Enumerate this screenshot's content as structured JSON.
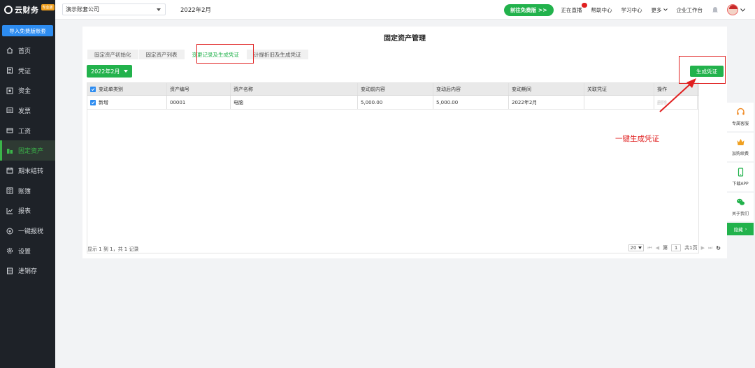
{
  "brand": {
    "name": "云财务",
    "badge": "专业版"
  },
  "sidebar": {
    "import_label": "导入免费版账套",
    "items": [
      {
        "label": "首页",
        "icon": "home-icon",
        "active": false
      },
      {
        "label": "凭证",
        "icon": "voucher-icon",
        "active": false
      },
      {
        "label": "资金",
        "icon": "funds-icon",
        "active": false
      },
      {
        "label": "发票",
        "icon": "invoice-icon",
        "active": false
      },
      {
        "label": "工资",
        "icon": "salary-icon",
        "active": false
      },
      {
        "label": "固定资产",
        "icon": "fixed-asset-icon",
        "active": true
      },
      {
        "label": "期末结转",
        "icon": "period-end-icon",
        "active": false
      },
      {
        "label": "账簿",
        "icon": "ledger-icon",
        "active": false
      },
      {
        "label": "报表",
        "icon": "report-icon",
        "active": false
      },
      {
        "label": "一键报税",
        "icon": "tax-icon",
        "active": false
      },
      {
        "label": "设置",
        "icon": "settings-icon",
        "active": false
      },
      {
        "label": "进销存",
        "icon": "inventory-icon",
        "active": false
      }
    ]
  },
  "topbar": {
    "company": "演示账套公司",
    "period": "2022年2月",
    "free_button": "前往免费版 >>",
    "links": {
      "live": "正在直播",
      "help": "帮助中心",
      "study": "学习中心",
      "more": "更多",
      "workbench": "企业工作台"
    }
  },
  "page": {
    "title": "固定资产管理",
    "tabs": [
      "固定资产初始化",
      "固定资产列表",
      "变更记录及生成凭证",
      "计提折旧及生成凭证"
    ],
    "active_tab": 2,
    "date_filter": "2022年2月",
    "generate_button": "生成凭证"
  },
  "table": {
    "columns": [
      "变动单类别",
      "资产编号",
      "资产名称",
      "变动前内容",
      "变动后内容",
      "变动期间",
      "关联凭证",
      "操作"
    ],
    "rows": [
      {
        "type": "新增",
        "asset_no": "00001",
        "asset_name": "电脑",
        "before": "5,000.00",
        "after": "5,000.00",
        "period": "2022年2月",
        "voucher": "",
        "action": "删除"
      }
    ]
  },
  "footer": {
    "summary": "显示 1 到 1，共 1 记录",
    "page_size": "20",
    "page_label": "第",
    "page_value": "1",
    "page_total": "共1页"
  },
  "annotation": {
    "text": "一键生成凭证",
    "color": "#e02020"
  },
  "float_bar": {
    "items": [
      {
        "label": "专属客服",
        "icon": "headset-icon"
      },
      {
        "label": "加购续费",
        "icon": "crown-icon"
      },
      {
        "label": "下载APP",
        "icon": "phone-icon"
      },
      {
        "label": "关于我们",
        "icon": "wechat-icon"
      }
    ],
    "hide_label": "隐藏"
  },
  "colors": {
    "accent": "#22b24c",
    "sidebar_bg": "#1e2228",
    "highlight": "#e02020",
    "blue": "#2d8cf0"
  }
}
